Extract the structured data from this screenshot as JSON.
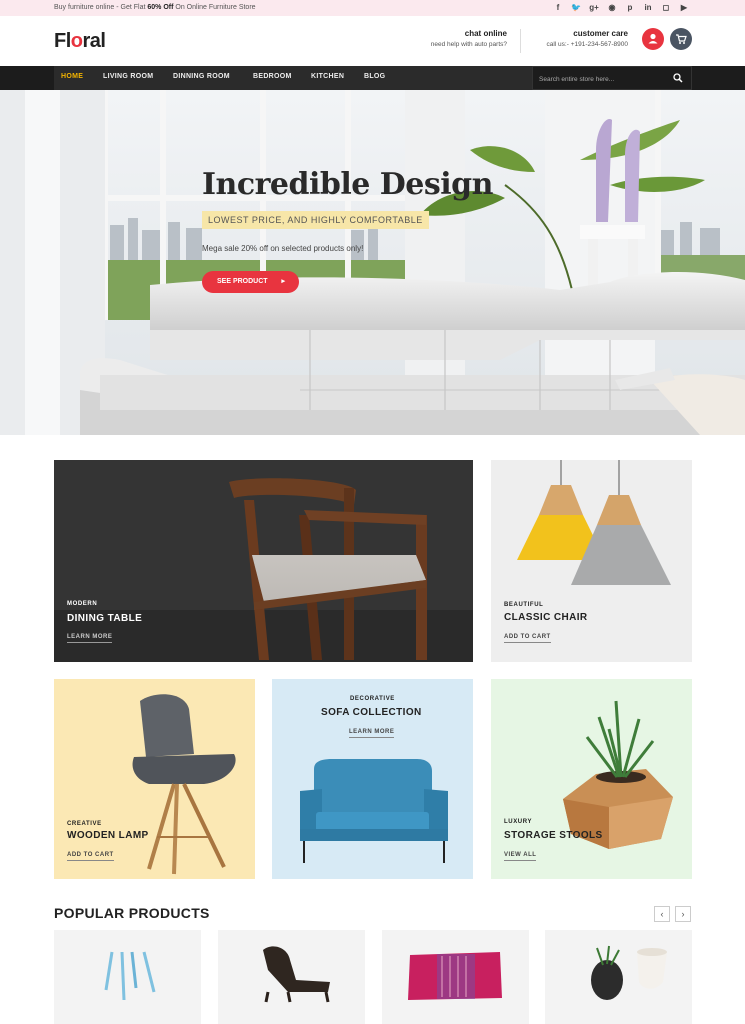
{
  "topbar": {
    "promo_prefix": "Buy furniture online - Get Flat ",
    "promo_bold": "60% Off",
    "promo_suffix": " On Online Furniture Store",
    "social": [
      "f",
      "t",
      "g+",
      "rss",
      "p",
      "in",
      "ig",
      "yt"
    ]
  },
  "header": {
    "logo": {
      "before": "Fl",
      "o": "o",
      "after": "ral"
    },
    "chat": {
      "title": "chat online",
      "sub": "need help with auto parts?"
    },
    "care": {
      "title": "customer care",
      "sub": "call us:- +191-234-567-8900"
    },
    "icons": [
      "user-icon",
      "cart-icon"
    ]
  },
  "nav": {
    "items": [
      "HOME",
      "LIVING ROOM",
      "DINNING ROOM",
      "BEDROOM",
      "KITCHEN",
      "BLOG"
    ],
    "active": "HOME",
    "search_placeholder": "Search entire store here..."
  },
  "hero": {
    "title": "Incredible Design",
    "tag": "LOWEST PRICE, AND HIGHLY COMFORTABLE",
    "subtitle": "Mega sale 20% off on selected products only!",
    "cta": "SEE PRODUCT"
  },
  "banners": [
    {
      "category": "MODERN",
      "title": "DINING TABLE",
      "link": "LEARN MORE"
    },
    {
      "category": "BEAUTIFUL",
      "title": "CLASSIC CHAIR",
      "link": "ADD TO CART"
    },
    {
      "category": "CREATIVE",
      "title": "WOODEN LAMP",
      "link": "ADD TO CART"
    },
    {
      "category": "DECORATIVE",
      "title": "SOFA COLLECTION",
      "link": "LEARN MORE"
    },
    {
      "category": "LUXURY",
      "title": "STORAGE STOOLS",
      "link": "VIEW ALL"
    }
  ],
  "popular": {
    "title": "POPULAR PRODUCTS",
    "prev": "‹",
    "next": "›"
  },
  "colors": {
    "accent": "#e8343f",
    "nav_active": "#f4b400",
    "nav_bg": "#2b2b2b"
  }
}
